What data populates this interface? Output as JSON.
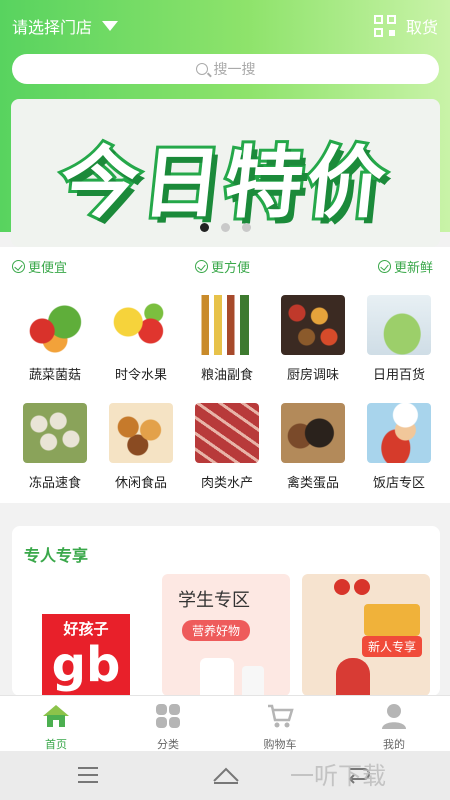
{
  "header": {
    "store_label": "请选择门店",
    "pickup_label": "取货",
    "search_placeholder": "搜一搜"
  },
  "banner": {
    "text": "今日特价",
    "slide_count": 3,
    "active_slide": 1
  },
  "features": [
    {
      "label": "更便宜"
    },
    {
      "label": "更方便"
    },
    {
      "label": "更新鲜"
    }
  ],
  "categories": [
    {
      "label": "蔬菜菌菇",
      "icon": "vegetables-icon"
    },
    {
      "label": "时令水果",
      "icon": "fruit-icon"
    },
    {
      "label": "粮油副食",
      "icon": "grain-oil-icon"
    },
    {
      "label": "厨房调味",
      "icon": "seasoning-icon"
    },
    {
      "label": "日用百货",
      "icon": "household-icon"
    },
    {
      "label": "冻品速食",
      "icon": "frozen-food-icon"
    },
    {
      "label": "休闲食品",
      "icon": "snacks-icon"
    },
    {
      "label": "肉类水产",
      "icon": "meat-icon"
    },
    {
      "label": "禽类蛋品",
      "icon": "poultry-icon"
    },
    {
      "label": "饭店专区",
      "icon": "chef-icon"
    }
  ],
  "exclusive": {
    "title": "专人专享",
    "cards": [
      {
        "logo_small": "好孩子",
        "logo_big": "gb"
      },
      {
        "title": "学生专区",
        "badge": "营养好物"
      },
      {
        "badge": "新人专享"
      }
    ]
  },
  "tabs": [
    {
      "label": "首页",
      "icon": "home-icon",
      "active": true
    },
    {
      "label": "分类",
      "icon": "category-icon",
      "active": false
    },
    {
      "label": "购物车",
      "icon": "cart-icon",
      "active": false
    },
    {
      "label": "我的",
      "icon": "profile-icon",
      "active": false
    }
  ],
  "watermark": "一听下载",
  "colors": {
    "brand_green": "#3aa84a",
    "hero_gradient_start": "#58d35f",
    "hero_gradient_end": "#c9f3a8"
  }
}
